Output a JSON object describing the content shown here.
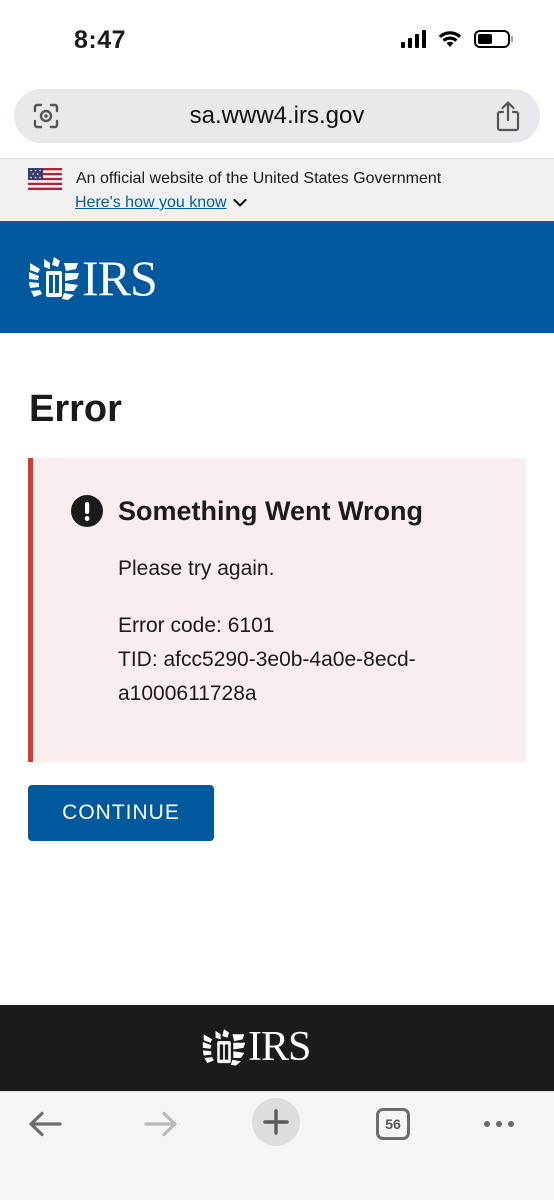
{
  "status_bar": {
    "time": "8:47"
  },
  "address_bar": {
    "url": "sa.www4.irs.gov"
  },
  "gov_banner": {
    "text": "An official website of the United States Government",
    "link": "Here's how you know"
  },
  "header": {
    "logo_text": "IRS"
  },
  "main": {
    "title": "Error",
    "alert": {
      "heading": "Something Went Wrong",
      "message": "Please try again.",
      "error_code": "Error code: 6101",
      "tid_line1": "TID: afcc5290-3e0b-4a0e-8ecd-",
      "tid_line2": "a1000611728a"
    },
    "continue_label": "CONTINUE"
  },
  "footer": {
    "logo_text": "IRS"
  },
  "toolbar": {
    "tab_count": "56"
  },
  "colors": {
    "brand_blue": "#00599c",
    "alert_border": "#d83933",
    "alert_bg": "#f9eeed",
    "footer_bg": "#1b1b1b"
  },
  "icons": [
    "page-scan-icon",
    "share-icon",
    "us-flag-icon",
    "chevron-down-icon",
    "irs-eagle-icon",
    "alert-exclamation-icon",
    "back-arrow-icon",
    "forward-arrow-icon",
    "plus-icon",
    "tabs-icon",
    "more-icon"
  ]
}
